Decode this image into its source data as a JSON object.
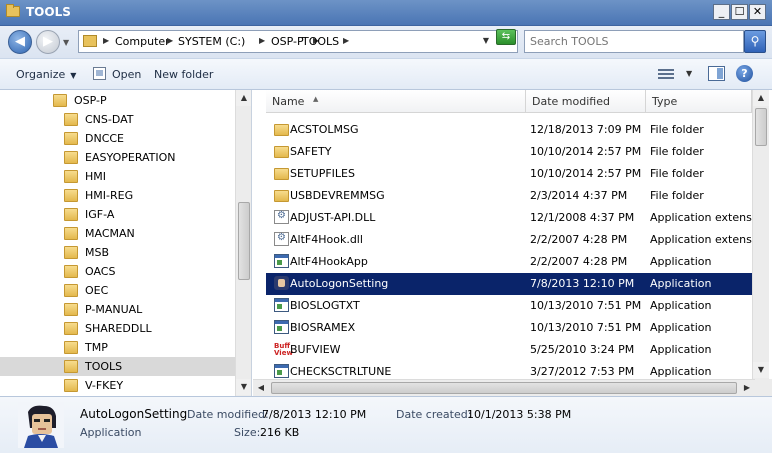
{
  "window": {
    "title": "TOOLS"
  },
  "address": {
    "crumbs": [
      "Computer",
      "SYSTEM (C:)",
      "OSP-P",
      "TOOLS"
    ],
    "search_placeholder": "Search TOOLS"
  },
  "toolbar": {
    "organize": "Organize",
    "open": "Open",
    "new_folder": "New folder"
  },
  "nav": {
    "root": "OSP-P",
    "items": [
      "CNS-DAT",
      "DNCCE",
      "EASYOPERATION",
      "HMI",
      "HMI-REG",
      "IGF-A",
      "MACMAN",
      "MSB",
      "OACS",
      "OEC",
      "P-MANUAL",
      "SHAREDDLL",
      "TMP",
      "TOOLS",
      "V-FKEY"
    ],
    "selected": "TOOLS"
  },
  "columns": {
    "name": "Name",
    "date": "Date modified",
    "type": "Type"
  },
  "files": [
    {
      "name": "ACSTOLMSG",
      "date": "12/18/2013 7:09 PM",
      "type": "File folder",
      "icon": "folder-icon"
    },
    {
      "name": "SAFETY",
      "date": "10/10/2014 2:57 PM",
      "type": "File folder",
      "icon": "folder-icon"
    },
    {
      "name": "SETUPFILES",
      "date": "10/10/2014 2:57 PM",
      "type": "File folder",
      "icon": "folder-icon"
    },
    {
      "name": "USBDEVREMMSG",
      "date": "2/3/2014 4:37 PM",
      "type": "File folder",
      "icon": "folder-icon"
    },
    {
      "name": "ADJUST-API.DLL",
      "date": "12/1/2008 4:37 PM",
      "type": "Application extension",
      "icon": "dll-icon"
    },
    {
      "name": "AltF4Hook.dll",
      "date": "2/2/2007 4:28 PM",
      "type": "Application extension",
      "icon": "dll-icon"
    },
    {
      "name": "AltF4HookApp",
      "date": "2/2/2007 4:28 PM",
      "type": "Application",
      "icon": "app-icon"
    },
    {
      "name": "AutoLogonSetting",
      "date": "7/8/2013 12:10 PM",
      "type": "Application",
      "icon": "face-icon",
      "selected": true
    },
    {
      "name": "BIOSLOGTXT",
      "date": "10/13/2010 7:51 PM",
      "type": "Application",
      "icon": "app-icon"
    },
    {
      "name": "BIOSRAMEX",
      "date": "10/13/2010 7:51 PM",
      "type": "Application",
      "icon": "app-icon"
    },
    {
      "name": "BUFVIEW",
      "date": "5/25/2010 3:24 PM",
      "type": "Application",
      "icon": "buff-icon"
    },
    {
      "name": "CHECKSCTRLTUNE",
      "date": "3/27/2012 7:53 PM",
      "type": "Application",
      "icon": "app-icon"
    }
  ],
  "details": {
    "name": "AutoLogonSetting",
    "date_modified_label": "Date modified:",
    "date_modified": "7/8/2013 12:10 PM",
    "date_created_label": "Date created:",
    "date_created": "10/1/2013 5:38 PM",
    "kind": "Application",
    "size_label": "Size:",
    "size": "216 KB"
  }
}
